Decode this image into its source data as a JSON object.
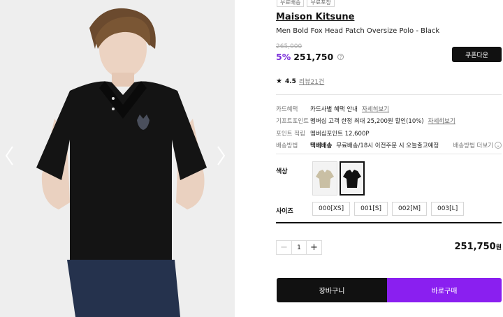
{
  "tags": [
    "무료배송",
    "무료포장"
  ],
  "product": {
    "brand": "Maison Kitsune",
    "name": "Men Bold Fox Head Patch Oversize Polo - Black",
    "original_price": "265,000",
    "discount": "5%",
    "price": "251,750",
    "coupon_label": "쿠폰다운"
  },
  "rating": {
    "score": "4.5",
    "reviews": "리뷰21건"
  },
  "info": {
    "card": {
      "label": "카드혜택",
      "value": "카드사별 혜택 안내",
      "link": "자세히보기"
    },
    "gift": {
      "label": "기프트포인트",
      "value": "멤버십 고객 한정 최대 25,200원 할인(10%)",
      "link": "자세히보기"
    },
    "points": {
      "label": "포인트 적립",
      "value": "멤버십포인트 12,600P"
    },
    "shipping": {
      "label": "배송방법",
      "method": "택배배송",
      "value": "무료배송/18시 이전주문 시 오늘출고예정",
      "link": "배송방법 더보기"
    }
  },
  "options": {
    "color_label": "색상",
    "size_label": "사이즈",
    "sizes": [
      "000[XS]",
      "001[S]",
      "002[M]",
      "003[L]"
    ]
  },
  "quantity": {
    "value": "1",
    "minus": "−",
    "plus": "+"
  },
  "total": {
    "amount": "251,750",
    "unit": "원"
  },
  "actions": {
    "cart": "장바구니",
    "buy": "바로구매"
  },
  "colors": {
    "accent": "#7b2fd9",
    "buy_button": "#8a1ff0",
    "swatch_beige": "#c9bfa4",
    "swatch_black": "#111111"
  }
}
